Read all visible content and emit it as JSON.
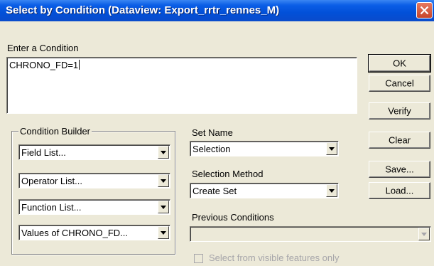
{
  "window": {
    "title": "Select by Condition (Dataview: Export_rrtr_rennes_M)"
  },
  "condition": {
    "label": "Enter a Condition",
    "value": "CHRONO_FD=1"
  },
  "builder": {
    "label": "Condition Builder",
    "field_list": "Field List...",
    "operator_list": "Operator List...",
    "function_list": "Function List...",
    "values_list": "Values of CHRONO_FD..."
  },
  "set_name": {
    "label": "Set Name",
    "value": "Selection"
  },
  "selection_method": {
    "label": "Selection Method",
    "value": "Create Set"
  },
  "previous_conditions": {
    "label": "Previous Conditions",
    "value": ""
  },
  "visible_only": {
    "label": "Select from visible features only",
    "checked": false
  },
  "buttons": {
    "ok": "OK",
    "cancel": "Cancel",
    "verify": "Verify",
    "clear": "Clear",
    "save": "Save...",
    "load": "Load..."
  },
  "colors": {
    "titlebar": "#0A5DE6",
    "dialog_bg": "#ECE9D8",
    "close": "#C8452A"
  }
}
